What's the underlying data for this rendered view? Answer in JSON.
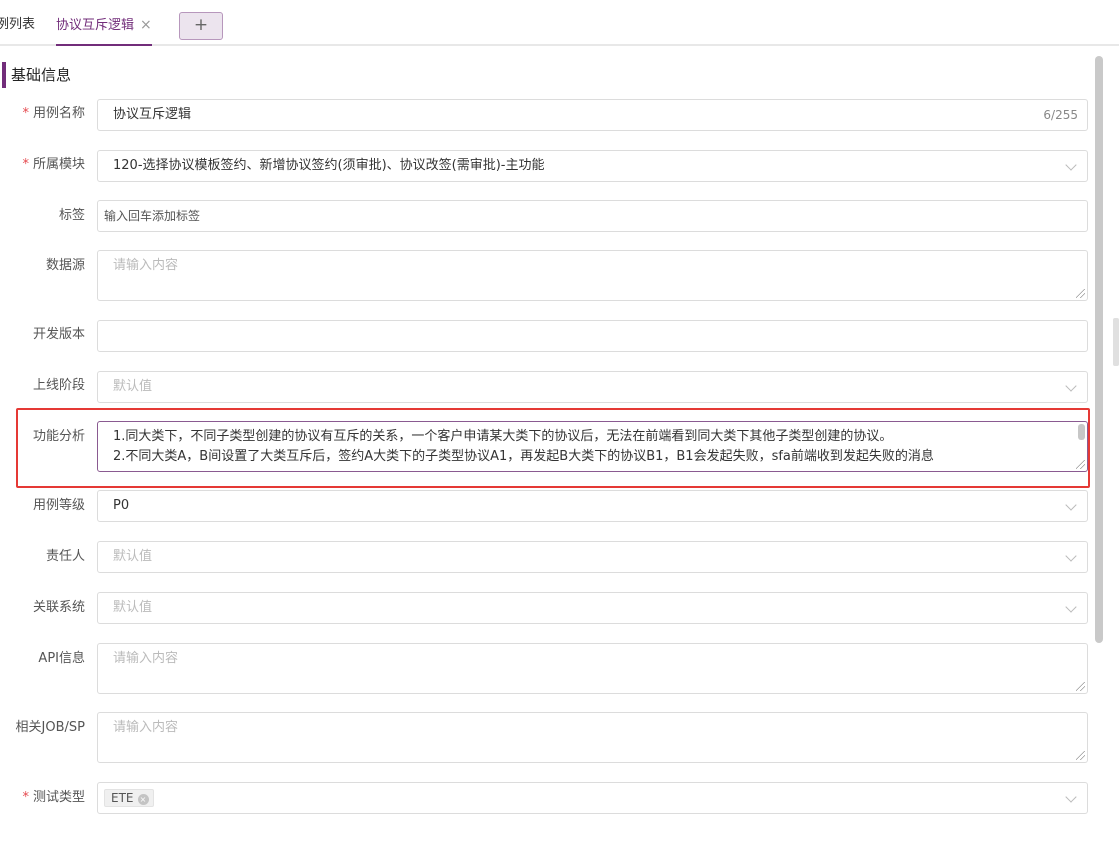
{
  "tabs": [
    {
      "label": "例列表"
    },
    {
      "label": "协议互斥逻辑",
      "active": true,
      "close": "×"
    }
  ],
  "add_tab_label": "+",
  "section": {
    "title": "基础信息"
  },
  "form": {
    "name": {
      "label": "用例名称",
      "required_mark": "*",
      "value": "协议互斥逻辑",
      "counter": "6/255"
    },
    "module": {
      "label": "所属模块",
      "required_mark": "*",
      "value": "120-选择协议模板签约、新增协议签约(须审批)、协议改签(需审批)-主功能"
    },
    "tags": {
      "label": "标签",
      "placeholder": "输入回车添加标签"
    },
    "datasource": {
      "label": "数据源",
      "placeholder": "请输入内容"
    },
    "dev_version": {
      "label": "开发版本",
      "value": ""
    },
    "stage": {
      "label": "上线阶段",
      "placeholder": "默认值"
    },
    "analysis": {
      "label": "功能分析",
      "lines": [
        "1.同大类下，不同子类型创建的协议有互斥的关系，一个客户申请某大类下的协议后，无法在前端看到同大类下其他子类型创建的协议。",
        "2.不同大类A，B间设置了大类互斥后，签约A大类下的子类型协议A1，再发起B大类下的协议B1，B1会发起失败，sfa前端收到发起失败的消息"
      ]
    },
    "level": {
      "label": "用例等级",
      "value": "P0"
    },
    "owner": {
      "label": "责任人",
      "placeholder": "默认值"
    },
    "systems": {
      "label": "关联系统",
      "placeholder": "默认值"
    },
    "api": {
      "label": "API信息",
      "placeholder": "请输入内容"
    },
    "job": {
      "label": "相关JOB/SP",
      "placeholder": "请输入内容"
    },
    "test_type": {
      "label": "测试类型",
      "required_mark": "*",
      "chip": "ETE",
      "chip_close": "×"
    }
  },
  "colors": {
    "accent": "#722d7a",
    "highlight_border": "#e53935",
    "required": "#e5484d"
  }
}
